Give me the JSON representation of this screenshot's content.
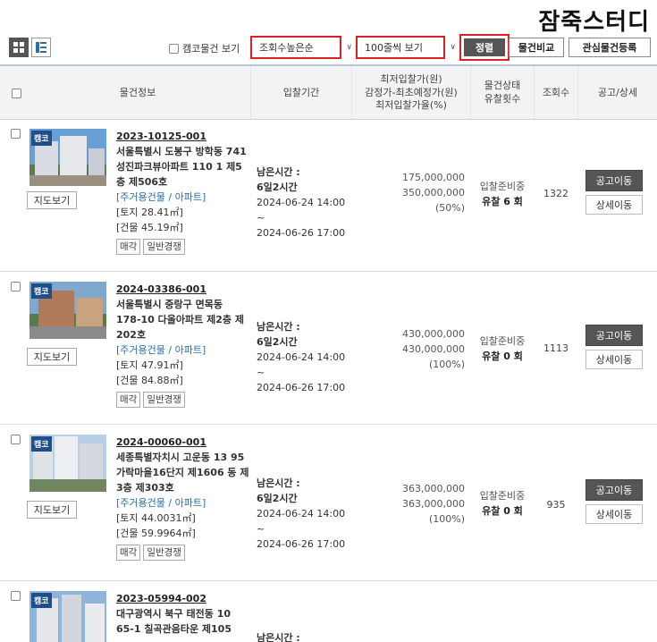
{
  "watermark": "잠죽스터디",
  "toolbar": {
    "camco_only_label": "캠코물건 보기",
    "sort_select_value": "조회수높은순",
    "page_size_value": "100줄씩 보기",
    "sort_button": "정렬",
    "compare_button": "물건비교",
    "register_interest_button": "관심물건등록"
  },
  "table": {
    "headers": {
      "info": "물건정보",
      "period": "입찰기간",
      "price_l1": "최저입찰가(원)",
      "price_l2": "감정가-최초예정가(원)",
      "price_l3": "최저입찰가율(%)",
      "status_l1": "물건상태",
      "status_l2": "유찰횟수",
      "views": "조회수",
      "notice": "공고/상세"
    },
    "common": {
      "badge": "캠코",
      "map_button": "지도보기",
      "category": "[주거용건물 / 아파트]",
      "tag_sale": "매각",
      "tag_general": "일반경쟁",
      "remaining_label": "남은시간 :",
      "notice_button": "공고이동",
      "detail_button": "상세이동"
    },
    "rows": [
      {
        "case_no": "2023-10125-001",
        "address": "서울특별시 도봉구 방학동 741 성진파크뷰아파트 110 1 제5층 제506호",
        "land": "[토지 28.41㎡]",
        "building": "[건물 45.19㎡]",
        "remaining": "6일2시간",
        "start": "2024-06-24 14:00 ~",
        "end": "2024-06-26 17:00",
        "min_price": "175,000,000",
        "appraisal": "350,000,000",
        "rate": "(50%)",
        "status": "입찰준비중",
        "fail_count": "유찰 6 회",
        "views": "1322"
      },
      {
        "case_no": "2024-03386-001",
        "address": "서울특별시 중랑구 면목동 178-10 다올아파트 제2층 제202호",
        "land": "[토지 47.91㎡]",
        "building": "[건물 84.88㎡]",
        "remaining": "6일2시간",
        "start": "2024-06-24 14:00 ~",
        "end": "2024-06-26 17:00",
        "min_price": "430,000,000",
        "appraisal": "430,000,000",
        "rate": "(100%)",
        "status": "입찰준비중",
        "fail_count": "유찰 0 회",
        "views": "1113"
      },
      {
        "case_no": "2024-00060-001",
        "address": "세종특별자치시 고운동 13 95 가락마을16단지 제1606 동 제3층 제303호",
        "land": "[토지 44.0031㎡]",
        "building": "[건물 59.9964㎡]",
        "remaining": "6일2시간",
        "start": "2024-06-24 14:00 ~",
        "end": "2024-06-26 17:00",
        "min_price": "363,000,000",
        "appraisal": "363,000,000",
        "rate": "(100%)",
        "status": "입찰준비중",
        "fail_count": "유찰 0 회",
        "views": "935"
      },
      {
        "case_no": "2023-05994-002",
        "address": "대구광역시 북구 태전동 10 65-1 칠곡관음타운 제105",
        "remaining_partial": "남은시간 :"
      }
    ]
  },
  "colors": {
    "highlight": "#e02020",
    "link": "#2a6ea8",
    "badge": "#1e4f8a",
    "button_dark": "#555555"
  }
}
